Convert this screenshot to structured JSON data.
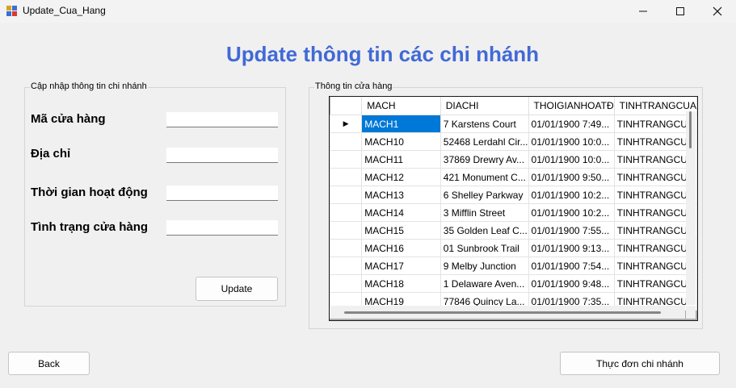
{
  "window": {
    "title": "Update_Cua_Hang",
    "minimize": "—",
    "maximize": "☐",
    "close": "✕"
  },
  "heading": "Update thông tin các chi nhánh",
  "left_group": {
    "label": "Cập nhập thông tin chi nhánh",
    "fields": {
      "ma": {
        "label": "Mã cửa hàng",
        "value": ""
      },
      "diachi": {
        "label": "Địa chỉ",
        "value": ""
      },
      "thoigian": {
        "label": "Thời gian hoạt động",
        "value": ""
      },
      "tinhtrang": {
        "label": "Tình trạng cửa hàng",
        "value": ""
      }
    },
    "update_button": "Update"
  },
  "right_group": {
    "label": "Thông tin cửa hàng",
    "columns": [
      "MACH",
      "DIACHI",
      "THOIGIANHOATĐ",
      "TINHTRANGCUA"
    ],
    "selected_marker": "▶",
    "rows": [
      [
        "MACH1",
        "7 Karstens Court",
        "01/01/1900 7:49...",
        "TINHTRANGCU..."
      ],
      [
        "MACH10",
        "52468 Lerdahl Cir...",
        "01/01/1900 10:0...",
        "TINHTRANGCU..."
      ],
      [
        "MACH11",
        "37869 Drewry Av...",
        "01/01/1900 10:0...",
        "TINHTRANGCU..."
      ],
      [
        "MACH12",
        "421 Monument C...",
        "01/01/1900 9:50...",
        "TINHTRANGCU..."
      ],
      [
        "MACH13",
        "6 Shelley Parkway",
        "01/01/1900 10:2...",
        "TINHTRANGCU..."
      ],
      [
        "MACH14",
        "3 Mifflin Street",
        "01/01/1900 10:2...",
        "TINHTRANGCU..."
      ],
      [
        "MACH15",
        "35 Golden Leaf C...",
        "01/01/1900 7:55...",
        "TINHTRANGCU..."
      ],
      [
        "MACH16",
        "01 Sunbrook Trail",
        "01/01/1900 9:13...",
        "TINHTRANGCU..."
      ],
      [
        "MACH17",
        "9 Melby Junction",
        "01/01/1900 7:54...",
        "TINHTRANGCU..."
      ],
      [
        "MACH18",
        "1 Delaware Aven...",
        "01/01/1900 9:48...",
        "TINHTRANGCU..."
      ],
      [
        "MACH19",
        "77846 Quincy La...",
        "01/01/1900 7:35...",
        "TINHTRANGCU..."
      ]
    ]
  },
  "footer": {
    "back": "Back",
    "menu": "Thực đơn chi nhánh"
  }
}
